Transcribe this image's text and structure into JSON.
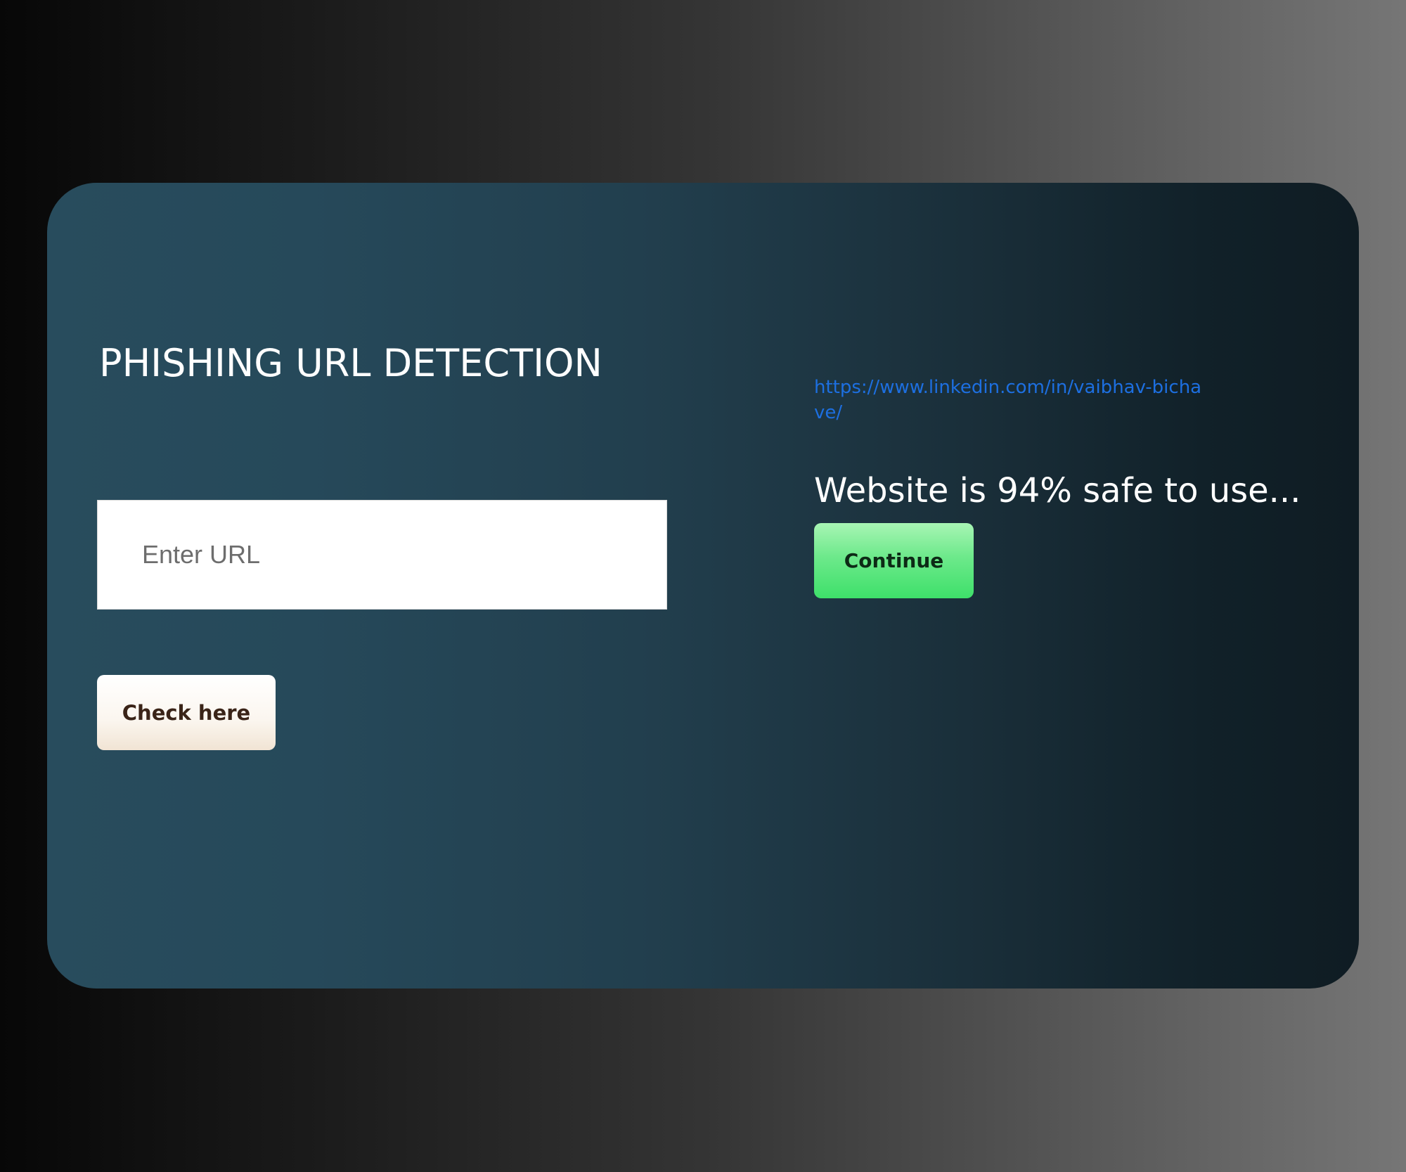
{
  "app": {
    "title": "PHISHING URL DETECTION"
  },
  "form": {
    "url_placeholder": "Enter URL",
    "url_value": "",
    "check_label": "Check here"
  },
  "result": {
    "url": "https://www.linkedin.com/in/vaibhav-bichave/",
    "safety_message": "Website is 94% safe to use...",
    "safety_percent": 94,
    "continue_label": "Continue"
  },
  "colors": {
    "card_start": "#284c5d",
    "card_end": "#0f1c23",
    "link": "#1d6fe0",
    "continue_button": "#3ee06a",
    "check_button": "#fbf6ef"
  }
}
